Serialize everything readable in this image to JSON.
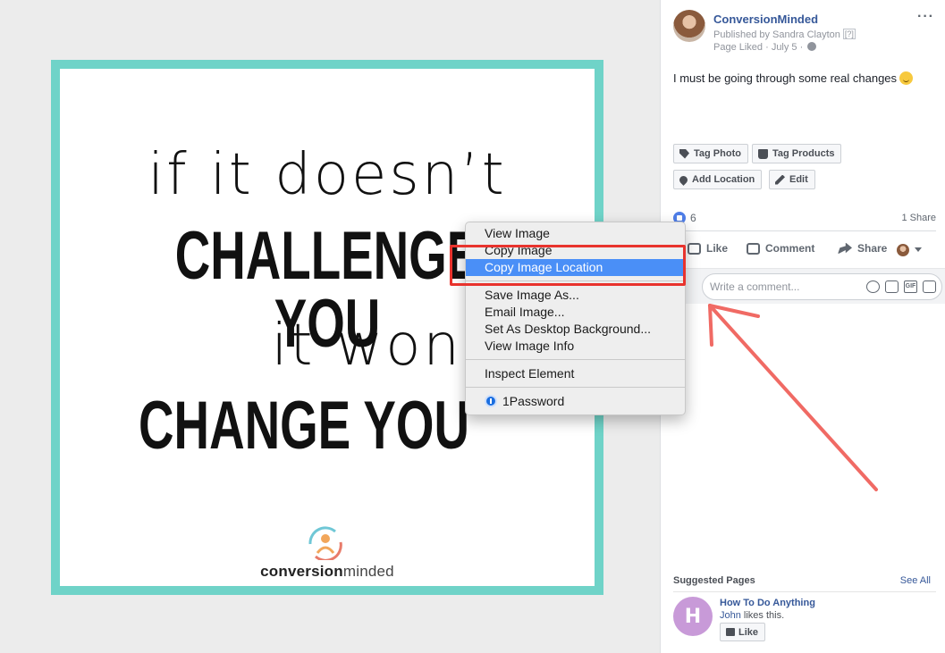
{
  "poster": {
    "line1": "if it doesn’t",
    "line2": "CHALLENGE YOU",
    "line3": "it won’t",
    "line4": "CHANGE YOU",
    "logo_bold": "conversion",
    "logo_light": "minded",
    "border_color": "#6fd3c8"
  },
  "post": {
    "page_name": "ConversionMinded",
    "published_by": "Published by Sandra Clayton",
    "published_q": "[?]",
    "meta": "Page Liked · July 5 ·",
    "more": "···",
    "text": "I must be going through some real changes",
    "buttons": {
      "tag_photo": "Tag Photo",
      "tag_products": "Tag Products",
      "add_location": "Add Location",
      "edit": "Edit"
    },
    "like_count": "6",
    "share_count": "1 Share",
    "actions": {
      "like": "Like",
      "comment": "Comment",
      "share": "Share"
    },
    "comment_placeholder": "Write a comment...",
    "comment_icons": {
      "gif": "GIF"
    }
  },
  "suggested": {
    "title": "Suggested Pages",
    "see_all": "See All",
    "avatar_letter": "H",
    "name": "How To Do Anything",
    "liker": "John",
    "liker_suffix": " likes this.",
    "like_button": "Like"
  },
  "context_menu": {
    "group1": [
      "View Image",
      "Copy Image",
      "Copy Image Location"
    ],
    "group2": [
      "Save Image As...",
      "Email Image...",
      "Set As Desktop Background...",
      "View Image Info"
    ],
    "group3": [
      "Inspect Element"
    ],
    "group4": [
      "1Password"
    ],
    "highlight_color": "#4a8ff7"
  },
  "annotation": {
    "color": "#e8332d"
  },
  "colors": {
    "link": "#365899",
    "avatar_h": "#c89ad8"
  }
}
